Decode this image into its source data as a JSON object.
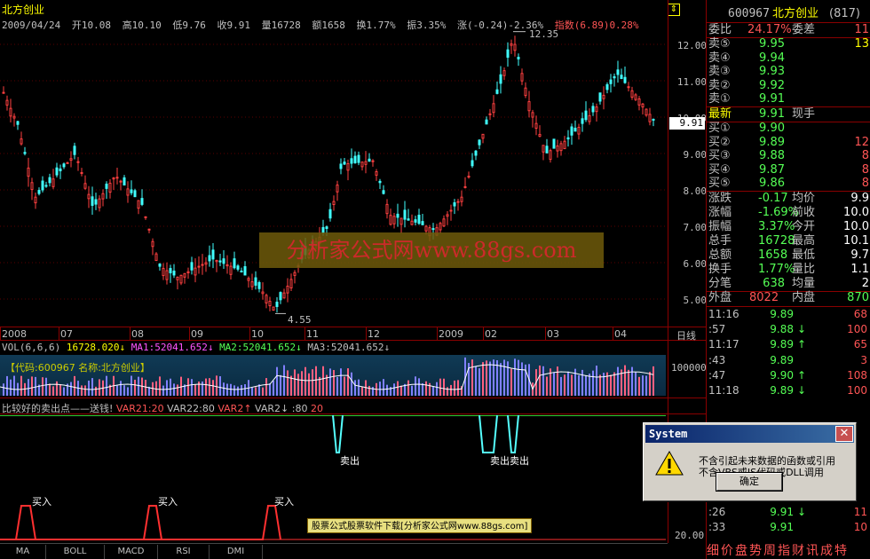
{
  "header": {
    "stock_name": "北方创业",
    "date": "2009/04/24",
    "open": "开10.08",
    "high": "高10.10",
    "low": "低9.76",
    "close": "收9.91",
    "volume": "量16728",
    "amount": "额1658",
    "turnover": "换1.77%",
    "amplitude": "振3.35%",
    "change": "涨(-0.24)-2.36%",
    "index_text": "指数(6.89)0.28%"
  },
  "price_axis": [
    "12.00",
    "11.00",
    "10.00",
    "9.00",
    "8.00",
    "7.00",
    "6.00",
    "5.00"
  ],
  "last_price_marker": "9.91",
  "annotations": {
    "high": "12.35",
    "low": "4.55"
  },
  "watermark": "分析家公式网www.88gs.com",
  "date_axis": [
    "2008",
    "07",
    "08",
    "09",
    "10",
    "11",
    "12",
    "2009",
    "02",
    "03",
    "04"
  ],
  "date_axis_right": "日线",
  "volume_panel": {
    "label": "VOL(6,6,6)",
    "value": "16728.020",
    "ma1": "MA1:52041.652",
    "ma2": "MA2:52041.652",
    "ma3": "MA3:52041.652",
    "code_tag": "【代码:600967 名称:北方创业】",
    "axis": "100000"
  },
  "indicator_panel": {
    "title": "比较好的卖出点——送钱!",
    "var21": "VAR21:20",
    "var22": "VAR22:80",
    "var2a": "VAR2",
    "var2b": "VAR2",
    "var2_value": ":80",
    "var2_value2": "20",
    "sell_labels": [
      "卖出",
      "卖出卖出"
    ],
    "buy_label": "买入",
    "axis_bottom": "20.00",
    "ad_text": "股票公式股票软件下载[分析家公式网www.88gs.com]"
  },
  "tabs": [
    "MA",
    "BOLL",
    "MACD",
    "RSI",
    "DMI"
  ],
  "right_panel": {
    "code": "600967",
    "name": "北方创业",
    "code_suffix": "(817)",
    "weibi_label": "委比",
    "weibi_value": "24.17%",
    "weicha_label": "委差",
    "weicha_value": "11",
    "sells": [
      {
        "label": "卖⑤",
        "price": "9.95",
        "vol": "13"
      },
      {
        "label": "卖④",
        "price": "9.94",
        "vol": ""
      },
      {
        "label": "卖③",
        "price": "9.93",
        "vol": ""
      },
      {
        "label": "卖②",
        "price": "9.92",
        "vol": ""
      },
      {
        "label": "卖①",
        "price": "9.91",
        "vol": ""
      }
    ],
    "latest_label": "最新",
    "latest_value": "9.91",
    "xianshou_label": "现手",
    "buys": [
      {
        "label": "买①",
        "price": "9.90",
        "vol": ""
      },
      {
        "label": "买②",
        "price": "9.89",
        "vol": "12"
      },
      {
        "label": "买③",
        "price": "9.88",
        "vol": "8"
      },
      {
        "label": "买④",
        "price": "9.87",
        "vol": "8"
      },
      {
        "label": "买⑤",
        "price": "9.86",
        "vol": "8"
      }
    ],
    "stats": [
      {
        "l1": "涨跌",
        "v1": "-0.17",
        "l2": "均价",
        "v2": "9.9"
      },
      {
        "l1": "涨幅",
        "v1": "-1.69%",
        "l2": "前收",
        "v2": "10.0"
      },
      {
        "l1": "振幅",
        "v1": "3.37%",
        "l2": "今开",
        "v2": "10.0"
      },
      {
        "l1": "总手",
        "v1": "16728",
        "l2": "最高",
        "v2": "10.1"
      },
      {
        "l1": "总额",
        "v1": "1658",
        "l2": "最低",
        "v2": "9.7"
      },
      {
        "l1": "换手",
        "v1": "1.77%",
        "l2": "量比",
        "v2": "1.1"
      },
      {
        "l1": "分笔",
        "v1": "638",
        "l2": "均量",
        "v2": "2"
      }
    ],
    "waipan_label": "外盘",
    "waipan_value": "8022",
    "neipan_label": "内盘",
    "neipan_value": "870",
    "ticks": [
      {
        "time": "11:16",
        "price": "9.89",
        "arrow": "",
        "vol": "68"
      },
      {
        "time": ":57",
        "price": "9.88",
        "arrow": "↓",
        "vol": "100"
      },
      {
        "time": "11:17",
        "price": "9.89",
        "arrow": "↑",
        "vol": "65"
      },
      {
        "time": ":43",
        "price": "9.89",
        "arrow": "",
        "vol": "3"
      },
      {
        "time": ":47",
        "price": "9.90",
        "arrow": "↑",
        "vol": "108"
      },
      {
        "time": "11:18",
        "price": "9.89",
        "arrow": "↓",
        "vol": "100"
      }
    ],
    "ticks_bottom": [
      {
        "time": ":26",
        "price": "9.91",
        "arrow": "↓",
        "vol": "11"
      },
      {
        "time": ":33",
        "price": "9.91",
        "arrow": "",
        "vol": "10"
      }
    ],
    "bottom_tabs": "细价盘势周指财讯成特"
  },
  "dialog": {
    "title": "System",
    "line1": "不含引起未来数据的函数或引用",
    "line2": "不含VBS或JS代码或DLL调用",
    "ok": "确定"
  }
}
